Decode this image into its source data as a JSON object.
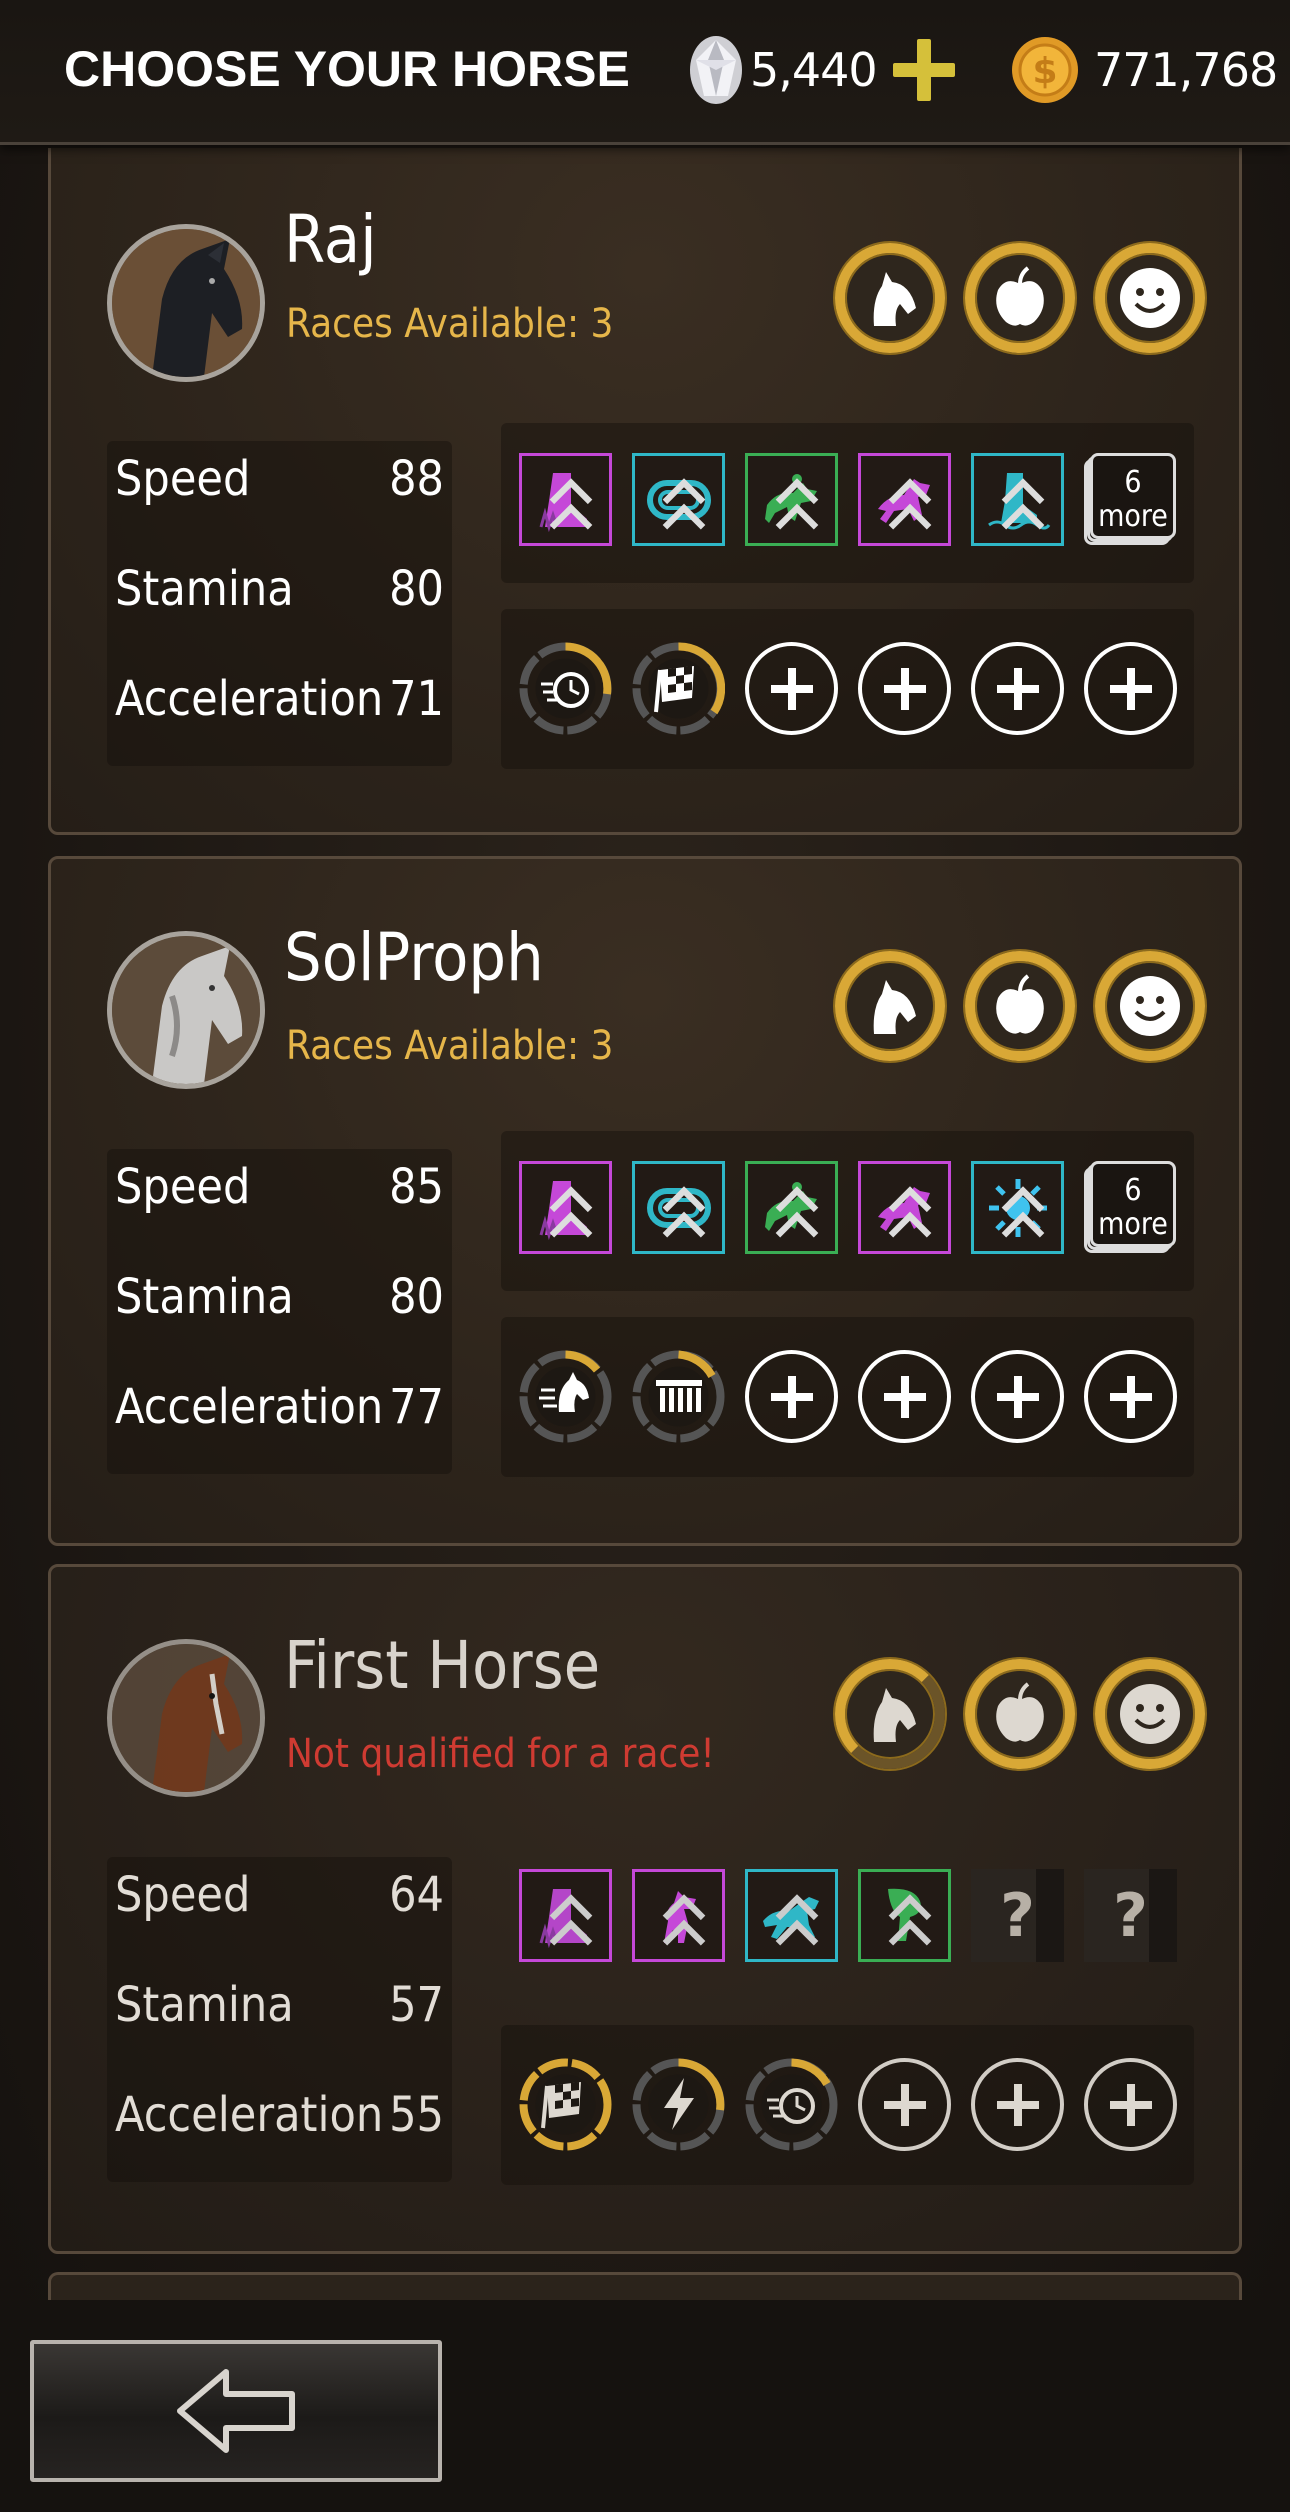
{
  "header": {
    "title": "CHOOSE YOUR HORSE",
    "gems": "5,440",
    "coins": "771,768"
  },
  "colors": {
    "gold": "#d9a836",
    "races_available": "#e6b64a",
    "not_qualified": "#cf3b32",
    "skill_pink": "#c548d8",
    "skill_blue": "#2fb7c7",
    "skill_green": "#3aae54"
  },
  "horses": [
    {
      "name": "Raj",
      "status": "Races Available: 3",
      "stats": [
        {
          "label": "Speed",
          "value": "88"
        },
        {
          "label": "Stamina",
          "value": "80"
        },
        {
          "label": "Acceleration",
          "value": "71"
        }
      ],
      "skills": [
        "hoof-grass-icon",
        "track-icon",
        "horses-racing-icon",
        "galloping-horse-icon",
        "hoof-water-icon"
      ],
      "more_count": "6",
      "more_label": "more",
      "gear": [
        "speed-clock-gear-icon",
        "checkered-flag-gear-icon"
      ],
      "empty_slots": 4
    },
    {
      "name": "SolProph",
      "status": "Races Available: 3",
      "stats": [
        {
          "label": "Speed",
          "value": "85"
        },
        {
          "label": "Stamina",
          "value": "80"
        },
        {
          "label": "Acceleration",
          "value": "77"
        }
      ],
      "skills": [
        "hoof-grass-icon",
        "track-icon",
        "horses-racing-icon",
        "galloping-horse-icon",
        "sun-icon"
      ],
      "more_count": "6",
      "more_label": "more",
      "gear": [
        "horse-head-speed-gear-icon",
        "starting-gate-gear-icon"
      ],
      "empty_slots": 4
    },
    {
      "name": "First Horse",
      "status": "Not qualified for a race!",
      "stats": [
        {
          "label": "Speed",
          "value": "64"
        },
        {
          "label": "Stamina",
          "value": "57"
        },
        {
          "label": "Acceleration",
          "value": "55"
        }
      ],
      "skills": [
        "hoof-grass-icon",
        "rearing-horse-icon",
        "running-horse-icon",
        "horse-leg-icon"
      ],
      "unknown_label": "?",
      "gear": [
        "checkered-flag-gear-icon",
        "lightning-gear-icon",
        "speed-clock-gear-icon"
      ],
      "empty_slots": 3
    }
  ],
  "footer": {
    "back_icon": "back-arrow-icon"
  }
}
